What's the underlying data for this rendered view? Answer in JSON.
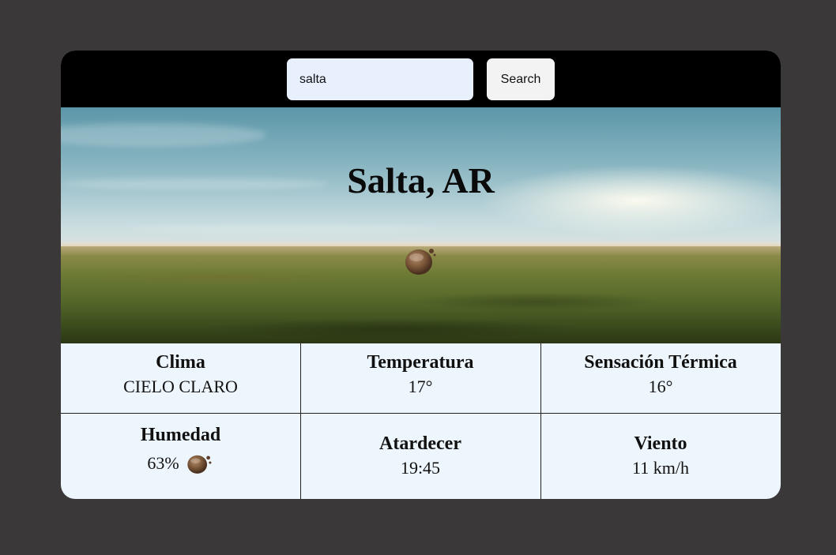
{
  "search": {
    "value": "salta",
    "button_label": "Search"
  },
  "hero": {
    "city": "Salta, AR",
    "weather_icon": "clear-sky-icon"
  },
  "stats": {
    "clima": {
      "label": "Clima",
      "value": "CIELO CLARO"
    },
    "temperatura": {
      "label": "Temperatura",
      "value": "17°"
    },
    "sensacion": {
      "label": "Sensación Térmica",
      "value": "16°"
    },
    "humedad": {
      "label": "Humedad",
      "value": "63%",
      "icon": "weather-icon"
    },
    "atardecer": {
      "label": "Atardecer",
      "value": "19:45"
    },
    "viento": {
      "label": "Viento",
      "value": "11 km/h"
    }
  },
  "colors": {
    "page_bg": "#3a3839",
    "topbar_bg": "#000000",
    "input_bg": "#e8f0fe",
    "grid_bg": "#eef6fd"
  }
}
